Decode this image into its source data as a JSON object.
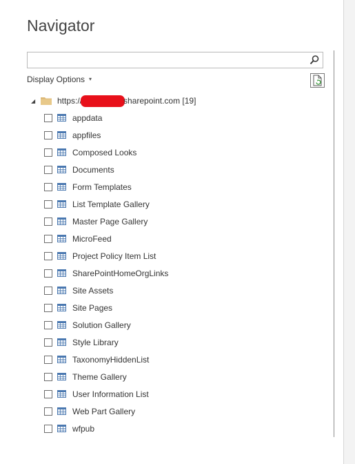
{
  "window": {
    "title": "Navigator"
  },
  "search": {
    "value": "",
    "placeholder": ""
  },
  "display_options": {
    "label": "Display Options",
    "caret": "▾"
  },
  "tree": {
    "root": {
      "prefix": "https://",
      "suffix": "sharepoint.com [19]",
      "expanded_glyph": "◢"
    },
    "items": [
      {
        "label": "appdata",
        "checked": false
      },
      {
        "label": "appfiles",
        "checked": false
      },
      {
        "label": "Composed Looks",
        "checked": false
      },
      {
        "label": "Documents",
        "checked": false
      },
      {
        "label": "Form Templates",
        "checked": false
      },
      {
        "label": "List Template Gallery",
        "checked": false
      },
      {
        "label": "Master Page Gallery",
        "checked": false
      },
      {
        "label": "MicroFeed",
        "checked": false
      },
      {
        "label": "Project Policy Item List",
        "checked": false
      },
      {
        "label": "SharePointHomeOrgLinks",
        "checked": false
      },
      {
        "label": "Site Assets",
        "checked": false
      },
      {
        "label": "Site Pages",
        "checked": false
      },
      {
        "label": "Solution Gallery",
        "checked": false
      },
      {
        "label": "Style Library",
        "checked": false
      },
      {
        "label": "TaxonomyHiddenList",
        "checked": false
      },
      {
        "label": "Theme Gallery",
        "checked": false
      },
      {
        "label": "User Information List",
        "checked": false
      },
      {
        "label": "Web Part Gallery",
        "checked": false
      },
      {
        "label": "wfpub",
        "checked": false
      }
    ]
  },
  "icons": {
    "search": "search-icon",
    "refresh": "refresh-document-icon",
    "folder": "folder-icon",
    "table": "table-icon"
  },
  "colors": {
    "folder": "#dcb877",
    "table_icon": "#4a78b0",
    "redaction": "#e8101a"
  }
}
